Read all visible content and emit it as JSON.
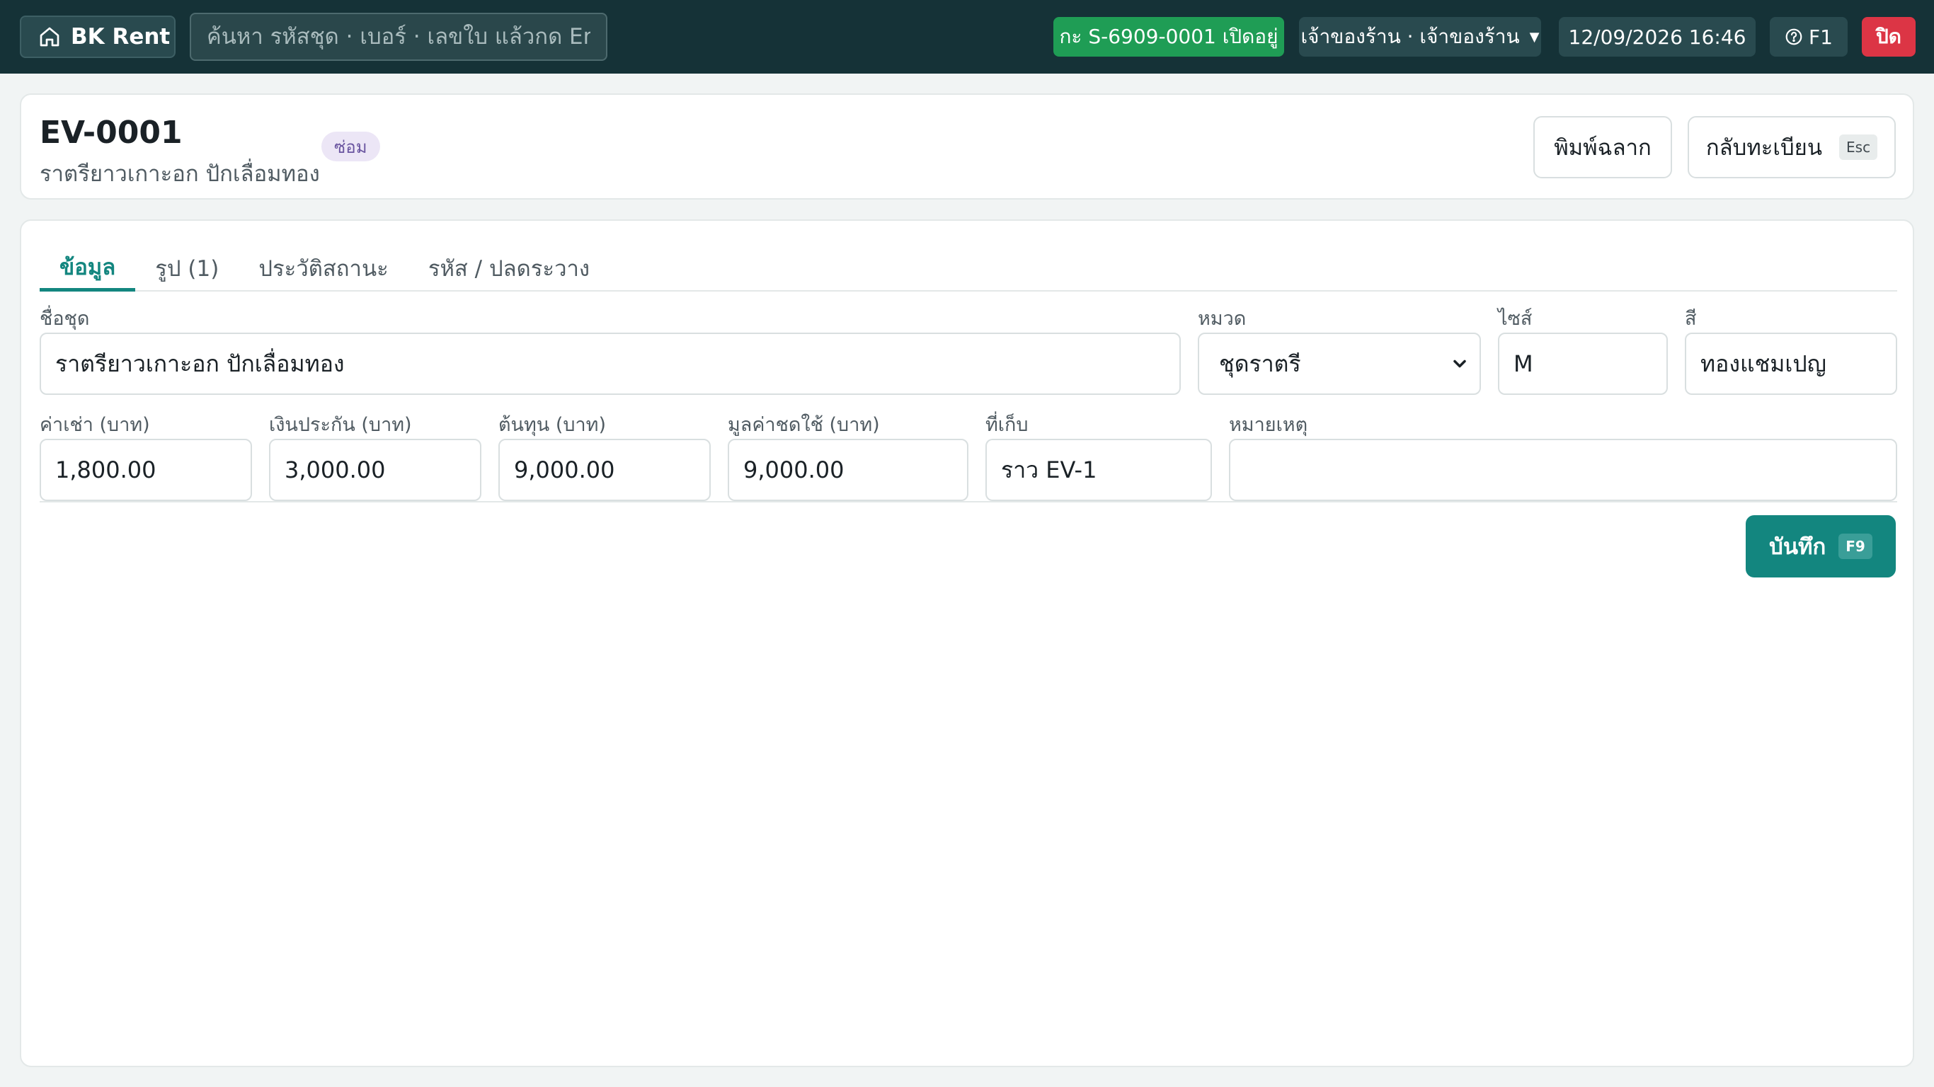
{
  "topbar": {
    "brand": "BK Rent",
    "search_placeholder": "ค้นหา รหัสชุด · เบอร์ · เลขใบ แล้วกด En...",
    "shift_status": "กะ S-6909-0001 เปิดอยู่",
    "user": "เจ้าของร้าน · เจ้าของร้าน",
    "datetime": "12/09/2026 16:46",
    "help_label": "F1",
    "close_label": "ปิด"
  },
  "header": {
    "code": "EV-0001",
    "name": "ราตรียาวเกาะอก ปักเลื่อมทอง",
    "status_badge": "ซ่อม",
    "print_label": "พิมพ์ฉลาก",
    "back_label": "กลับทะเบียน",
    "back_key": "Esc"
  },
  "tabs": [
    {
      "label": "ข้อมูล",
      "active": true
    },
    {
      "label": "รูป (1)",
      "active": false
    },
    {
      "label": "ประวัติสถานะ",
      "active": false
    },
    {
      "label": "รหัส / ปลดระวาง",
      "active": false
    }
  ],
  "form": {
    "name": {
      "label": "ชื่อชุด",
      "value": "ราตรียาวเกาะอก ปักเลื่อมทอง"
    },
    "category": {
      "label": "หมวด",
      "value": "ชุดราตรี"
    },
    "size": {
      "label": "ไซส์",
      "value": "M"
    },
    "color": {
      "label": "สี",
      "value": "ทองแชมเปญ"
    },
    "rent_price": {
      "label": "ค่าเช่า (บาท)",
      "value": "1,800.00"
    },
    "deposit": {
      "label": "เงินประกัน (บาท)",
      "value": "3,000.00"
    },
    "cost": {
      "label": "ต้นทุน (บาท)",
      "value": "9,000.00"
    },
    "compensation": {
      "label": "มูลค่าชดใช้ (บาท)",
      "value": "9,000.00"
    },
    "location": {
      "label": "ที่เก็บ",
      "value": "ราว EV-1"
    },
    "note": {
      "label": "หมายเหตุ",
      "value": ""
    },
    "save_label": "บันทึก",
    "save_key": "F9"
  }
}
